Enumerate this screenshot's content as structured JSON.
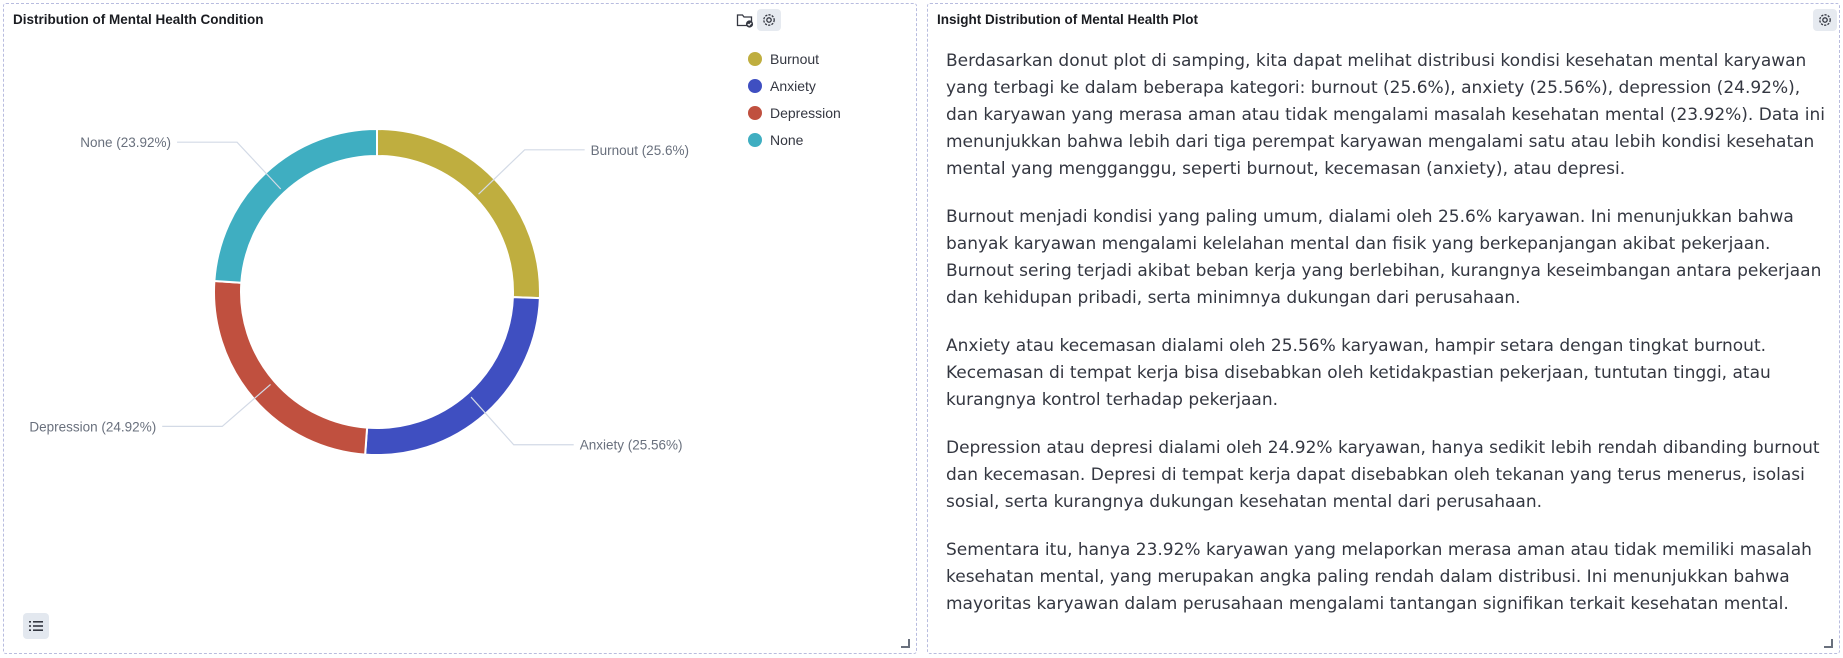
{
  "left_panel": {
    "title": "Distribution of Mental Health Condition",
    "icons": [
      "folder-check-icon",
      "gear-icon"
    ],
    "legend_button_icon": "list-icon"
  },
  "right_panel": {
    "title": "Insight Distribution of Mental Health Plot",
    "icons": [
      "gear-icon"
    ],
    "paragraphs": [
      "Berdasarkan donut plot di samping, kita dapat melihat distribusi kondisi kesehatan mental karyawan yang terbagi ke dalam beberapa kategori: burnout (25.6%), anxiety (25.56%), depression (24.92%), dan karyawan yang merasa aman atau tidak mengalami masalah kesehatan mental (23.92%). Data ini menunjukkan bahwa lebih dari tiga perempat karyawan mengalami satu atau lebih kondisi kesehatan mental yang mengganggu, seperti burnout, kecemasan (anxiety), atau depresi.",
      "Burnout menjadi kondisi yang paling umum, dialami oleh 25.6% karyawan. Ini menunjukkan bahwa banyak karyawan mengalami kelelahan mental dan fisik yang berkepanjangan akibat pekerjaan. Burnout sering terjadi akibat beban kerja yang berlebihan, kurangnya keseimbangan antara pekerjaan dan kehidupan pribadi, serta minimnya dukungan dari perusahaan.",
      "Anxiety atau kecemasan dialami oleh 25.56% karyawan, hampir setara dengan tingkat burnout. Kecemasan di tempat kerja bisa disebabkan oleh ketidakpastian pekerjaan, tuntutan tinggi, atau kurangnya kontrol terhadap pekerjaan.",
      "Depression atau depresi dialami oleh 24.92% karyawan, hanya sedikit lebih rendah dibanding burnout dan kecemasan. Depresi di tempat kerja dapat disebabkan oleh tekanan yang terus menerus, isolasi sosial, serta kurangnya dukungan kesehatan mental dari perusahaan.",
      "Sementara itu, hanya 23.92% karyawan yang melaporkan merasa aman atau tidak memiliki masalah kesehatan mental, yang merupakan angka paling rendah dalam distribusi. Ini menunjukkan bahwa mayoritas karyawan dalam perusahaan mengalami tantangan signifikan terkait kesehatan mental."
    ]
  },
  "chart_data": {
    "type": "pie",
    "donut": true,
    "legend_position": "top-right",
    "slices": [
      {
        "name": "Burnout",
        "value": 25.6,
        "label": "Burnout (25.6%)",
        "color": "#bfae3f"
      },
      {
        "name": "Anxiety",
        "value": 25.56,
        "label": "Anxiety (25.56%)",
        "color": "#3f4fc1"
      },
      {
        "name": "Depression",
        "value": 24.92,
        "label": "Depression (24.92%)",
        "color": "#c0503f"
      },
      {
        "name": "None",
        "value": 23.92,
        "label": "None (23.92%)",
        "color": "#3faec1"
      }
    ]
  }
}
